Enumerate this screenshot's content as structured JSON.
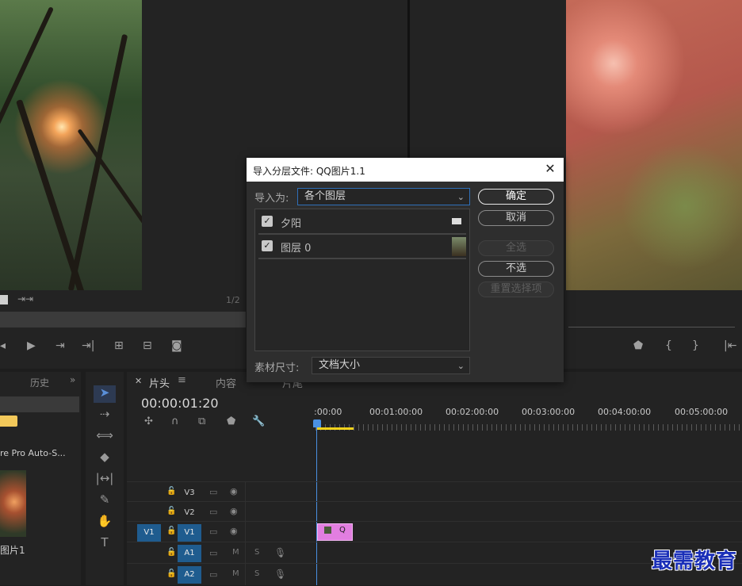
{
  "source_monitor": {
    "page_indicator": "1/2"
  },
  "project_panel": {
    "tab_history": "历史",
    "item_label": "re Pro Auto-S...",
    "thumb_label": "图片1"
  },
  "timeline": {
    "tabs": [
      "片头",
      "内容",
      "片尾"
    ],
    "timecode": "00:00:01:20",
    "ruler": [
      ":00:00",
      "00:01:00:00",
      "00:02:00:00",
      "00:03:00:00",
      "00:04:00:00",
      "00:05:00:00"
    ],
    "video_tracks": [
      "V3",
      "V2",
      "V1"
    ],
    "audio_tracks": [
      "A1",
      "A2"
    ],
    "source_patch_v": "V1",
    "track_toggle_m": "M",
    "track_toggle_s": "S",
    "clip_label": "Q"
  },
  "dialog": {
    "title": "导入分层文件: QQ图片1.1",
    "close": "✕",
    "import_as_label": "导入为:",
    "import_as_value": "各个图层",
    "layers": [
      {
        "name": "夕阳",
        "checked": true
      },
      {
        "name": "图层 0",
        "checked": true
      }
    ],
    "footage_size_label": "素材尺寸:",
    "footage_size_value": "文档大小",
    "buttons": {
      "ok": "确定",
      "cancel": "取消",
      "select_all": "全选",
      "deselect": "不选",
      "reset": "重置选择项"
    }
  },
  "watermark": "最需教育",
  "colors": {
    "accent_blue": "#1f5c8f",
    "playhead": "#4a90e2",
    "clip_pink": "#e27ee0",
    "workarea": "#f2d21b"
  }
}
